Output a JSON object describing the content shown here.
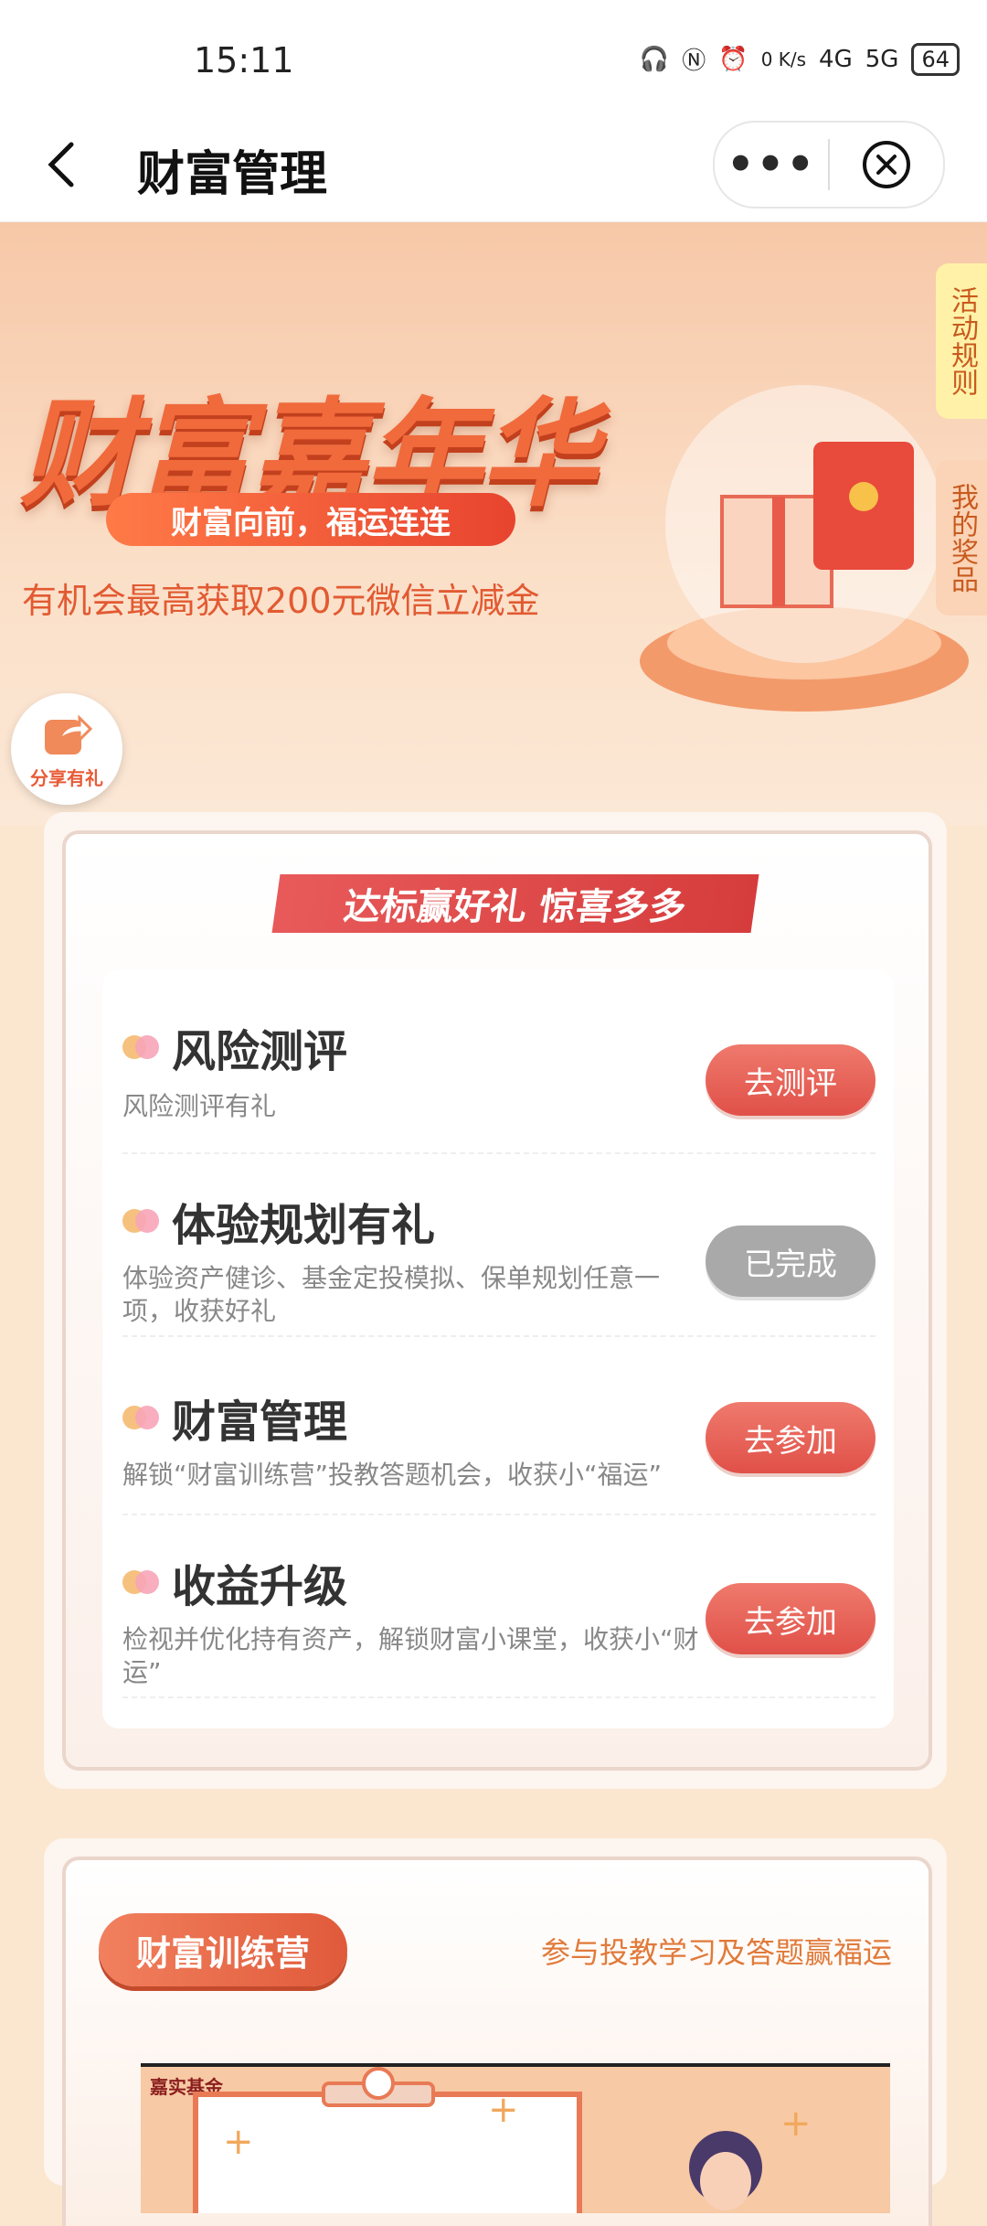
{
  "status_bar": {
    "time": "15:11",
    "net_speed": "0 K/s",
    "net1": "4G",
    "net2": "5G",
    "battery": "64"
  },
  "nav": {
    "title": "财富管理"
  },
  "banner": {
    "title": "财富嘉年华",
    "subtitle": "财富向前，福运连连",
    "desc": "有机会最高获取200元微信立减金",
    "rule_tab": "活动规则",
    "prize_tab": "我的奖品",
    "share_label": "分享有礼"
  },
  "tasks_card": {
    "ribbon": "达标赢好礼 惊喜多多",
    "tasks": [
      {
        "title": "风险测评",
        "desc": "风险测评有礼",
        "button": "去测评"
      },
      {
        "title": "体验规划有礼",
        "desc": "体验资产健诊、基金定投模拟、保单规划任意一项，收获好礼",
        "button": "已完成"
      },
      {
        "title": "财富管理",
        "desc": "解锁“财富训练营”投教答题机会，收获小“福运”",
        "button": "去参加"
      },
      {
        "title": "收益升级",
        "desc": "检视并优化持有资产，解锁财富小课堂，收获小“财运”",
        "button": "去参加"
      }
    ]
  },
  "camp_card": {
    "badge": "财富训练营",
    "subtitle": "参与投教学习及答题赢福运",
    "video_logo": "嘉实基金"
  }
}
